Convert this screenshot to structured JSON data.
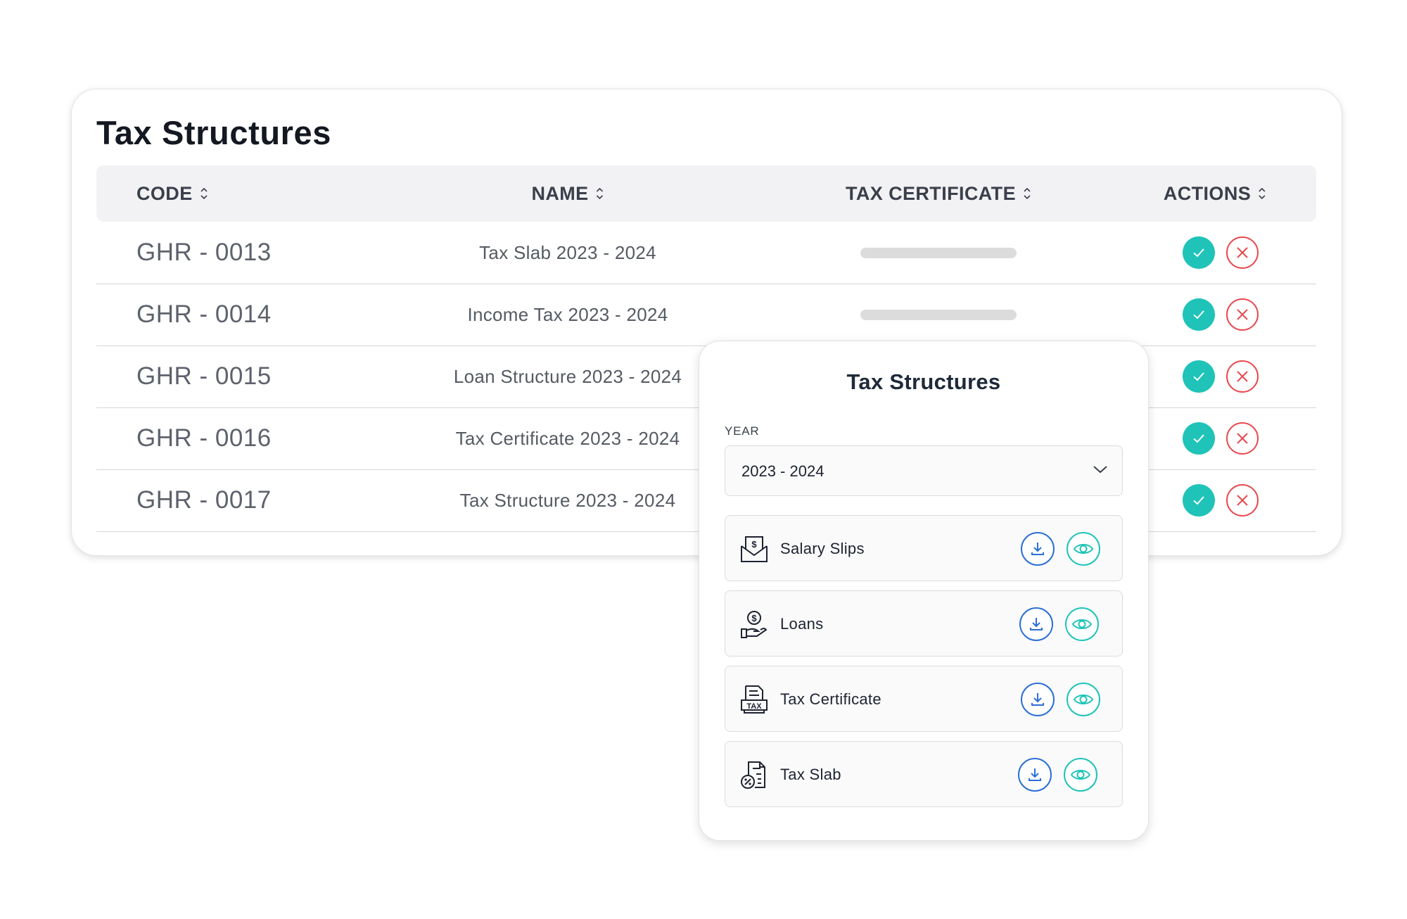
{
  "table": {
    "title": "Tax Structures",
    "columns": {
      "code": "CODE",
      "name": "NAME",
      "certificate": "TAX CERTIFICATE",
      "actions": "ACTIONS"
    },
    "rows": [
      {
        "code": "GHR - 0013",
        "name": "Tax Slab 2023 - 2024"
      },
      {
        "code": "GHR - 0014",
        "name": "Income Tax 2023 - 2024"
      },
      {
        "code": "GHR - 0015",
        "name": "Loan Structure 2023 - 2024"
      },
      {
        "code": "GHR - 0016",
        "name": "Tax Certificate 2023 - 2024"
      },
      {
        "code": "GHR - 0017",
        "name": "Tax Structure 2023 - 2024"
      }
    ]
  },
  "popup": {
    "title": "Tax Structures",
    "year_label": "YEAR",
    "year_value": "2023 - 2024",
    "items": [
      {
        "label": "Salary Slips",
        "icon": "salary-slip-icon"
      },
      {
        "label": "Loans",
        "icon": "loan-hand-coin-icon"
      },
      {
        "label": "Tax Certificate",
        "icon": "tax-document-icon"
      },
      {
        "label": "Tax Slab",
        "icon": "tax-slab-document-icon"
      }
    ]
  },
  "colors": {
    "accept": "#1fc3b8",
    "reject": "#e9494f",
    "download": "#2b6fd6",
    "view": "#1fc3b8",
    "header_bg": "#f2f2f5"
  }
}
